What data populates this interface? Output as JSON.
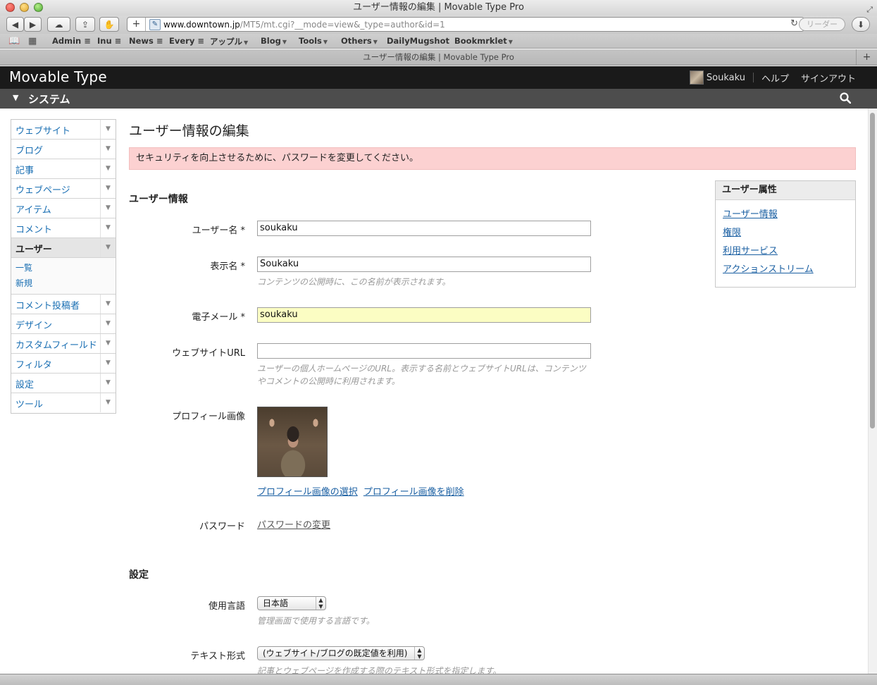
{
  "browser": {
    "window_title": "ユーザー情報の編集 | Movable Type Pro",
    "url_host": "www.downtown.jp",
    "url_path": "/MT5/mt.cgi?__mode=view&_type=author&id=1",
    "reader_label": "リーダー",
    "tab_title": "ユーザー情報の編集 | Movable Type Pro",
    "bookmarks": [
      "Admin ≡",
      "Inu ≡",
      "News ≡",
      "Every ≡",
      "アップル",
      "Blog",
      "Tools",
      "Others",
      "DailyMugshot",
      "Bookmrklet"
    ]
  },
  "header": {
    "logo": "Movable Type",
    "username": "Soukaku",
    "help": "ヘルプ",
    "signout": "サインアウト"
  },
  "sysbar": {
    "title": "システム"
  },
  "sidebar": {
    "items": [
      {
        "label": "ウェブサイト"
      },
      {
        "label": "ブログ"
      },
      {
        "label": "記事"
      },
      {
        "label": "ウェブページ"
      },
      {
        "label": "アイテム"
      },
      {
        "label": "コメント"
      },
      {
        "label": "ユーザー"
      },
      {
        "label": "コメント投稿者"
      },
      {
        "label": "デザイン"
      },
      {
        "label": "カスタムフィールド"
      },
      {
        "label": "フィルタ"
      },
      {
        "label": "設定"
      },
      {
        "label": "ツール"
      }
    ],
    "sub_items": [
      "一覧",
      "新規"
    ]
  },
  "main": {
    "title": "ユーザー情報の編集",
    "alert": "セキュリティを向上させるために、パスワードを変更してください。",
    "section_user": "ユーザー情報",
    "username_label": "ユーザー名 *",
    "username_value": "soukaku",
    "display_label": "表示名 *",
    "display_value": "Soukaku",
    "display_hint": "コンテンツの公開時に、この名前が表示されます。",
    "email_label": "電子メール *",
    "email_value": "soukaku",
    "url_label": "ウェブサイトURL",
    "url_value": "",
    "url_hint": "ユーザーの個人ホームページのURL。表示する名前とウェブサイトURLは、コンテンツやコメントの公開時に利用されます。",
    "photo_label": "プロフィール画像",
    "photo_select": "プロフィール画像の選択",
    "photo_delete": "プロフィール画像を削除",
    "password_label": "パスワード",
    "password_change": "パスワードの変更",
    "section_settings": "設定",
    "lang_label": "使用言語",
    "lang_value": "日本語",
    "lang_hint": "管理画面で使用する言語です。",
    "textformat_label": "テキスト形式",
    "textformat_value": "(ウェブサイト/ブログの既定値を利用)",
    "textformat_hint": "記事とウェブページを作成する際のテキスト形式を指定します。"
  },
  "widget": {
    "title": "ユーザー属性",
    "links": [
      "ユーザー情報",
      "権限",
      "利用サービス",
      "アクションストリーム"
    ]
  }
}
